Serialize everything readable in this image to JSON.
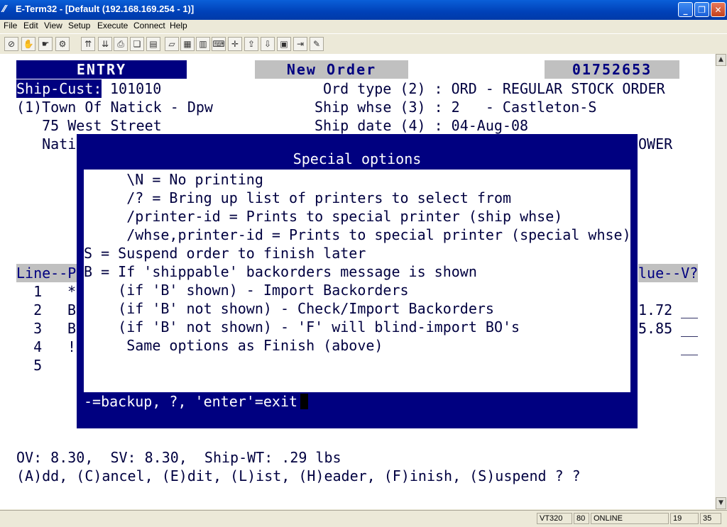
{
  "window": {
    "title": "E-Term32 - [Default (192.168.169.254 - 1)]"
  },
  "menu": [
    "File",
    "Edit",
    "View",
    "Setup",
    "Execute",
    "Connect",
    "Help"
  ],
  "header": {
    "mode": "ENTRY",
    "screen": "New Order",
    "order_no": "01752653",
    "ship_cust_label": "Ship-Cust:",
    "ship_cust_value": "101010",
    "cust_name": "(1)Town Of Natick - Dpw",
    "address1": "   75 West Street",
    "address2_partial": "   Nati",
    "ord_type": "Ord type (2) : ORD - REGULAR STOCK ORDER",
    "ship_whse": "Ship whse (3) : 2   - Castleton-S",
    "ship_date": "Ship date (4) : 04-Aug-08",
    "right_partial": "OWER"
  },
  "lines": {
    "header_left": "Line--P",
    "header_right": "lue--V?",
    "rows": [
      {
        "num": "  1",
        "flag": "*",
        "value": "",
        "blank": ""
      },
      {
        "num": "  2",
        "flag": "B",
        "value": "1.72",
        "blank": "__"
      },
      {
        "num": "  3",
        "flag": "B",
        "value": "5.85",
        "blank": "__"
      },
      {
        "num": "  4",
        "flag": "!",
        "value": "",
        "blank": "__"
      },
      {
        "num": "  5",
        "flag": "",
        "value": "",
        "blank": ""
      }
    ]
  },
  "popup": {
    "title": "Special options",
    "lines": [
      "     \\N = No printing",
      "     /? = Bring up list of printers to select from",
      "     /printer-id = Prints to special printer (ship whse)",
      "     /whse,printer-id = Prints to special printer (special whse)",
      "S = Suspend order to finish later",
      "B = If 'shippable' backorders message is shown",
      "    (if 'B' shown) - Import Backorders",
      "    (if 'B' not shown) - Check/Import Backorders",
      "    (if 'B' not shown) - 'F' will blind-import BO's",
      "     Same options as Finish (above)"
    ],
    "footer": "-=backup, ?, 'enter'=exit"
  },
  "footer": {
    "totals": "OV: 8.30,  SV: 8.30,  Ship-WT: .29 lbs",
    "prompt": "(A)dd, (C)ancel, (E)dit, (L)ist, (H)eader, (F)inish, (S)uspend ? ?"
  },
  "status": {
    "emulation": "VT320",
    "cols": "80",
    "state": "ONLINE",
    "row": "19",
    "col": "35"
  }
}
